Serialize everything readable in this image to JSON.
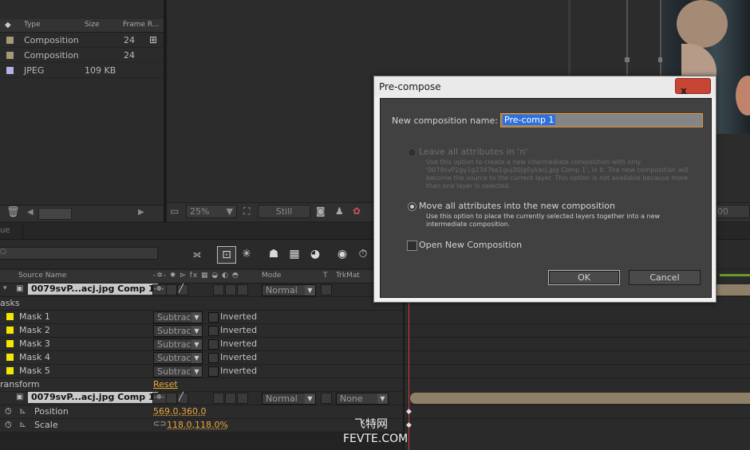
{
  "project": {
    "columns": {
      "type": "Type",
      "size": "Size",
      "frame_rate": "Frame R..."
    },
    "rows": [
      {
        "type": "Composition",
        "size": "",
        "frame_rate": "24",
        "swatch": "#a59977"
      },
      {
        "type": "Composition",
        "size": "",
        "frame_rate": "24",
        "swatch": "#a59977"
      },
      {
        "type": "JPEG",
        "size": "109 KB",
        "frame_rate": "",
        "swatch": "#b3b3e0"
      }
    ]
  },
  "viewer": {
    "zoom": "25%",
    "resolution": "Still"
  },
  "timeline": {
    "tab_partial": "ue",
    "columns": {
      "source_name": "Source Name",
      "mode": "Mode",
      "t": "T",
      "trkmat": "TrkMat"
    },
    "layer1": {
      "name": "0079svP...acj.jpg Comp 1",
      "mode": "Normal"
    },
    "masks_header": "asks",
    "masks": [
      {
        "name": "Mask 1",
        "mode": "Subtrac",
        "inverted": "Inverted"
      },
      {
        "name": "Mask 2",
        "mode": "Subtrac",
        "inverted": "Inverted"
      },
      {
        "name": "Mask 3",
        "mode": "Subtrac",
        "inverted": "Inverted"
      },
      {
        "name": "Mask 4",
        "mode": "Subtrac",
        "inverted": "Inverted"
      },
      {
        "name": "Mask 5",
        "mode": "Subtrac",
        "inverted": "Inverted"
      }
    ],
    "transform_header": "ransform",
    "reset": "Reset",
    "layer2": {
      "name": "0079svP...acj.jpg Comp 1",
      "mode": "Normal",
      "trkmat": "None"
    },
    "position": {
      "label": "Position",
      "value": "569.0,360.0"
    },
    "scale": {
      "label": "Scale",
      "value": "118.0,118.0%"
    }
  },
  "dialog": {
    "title": "Pre-compose",
    "close": "x",
    "name_label": "New composition name:",
    "name_value": "Pre-comp 1",
    "option_leave": {
      "label": "Leave all attributes in 'n'",
      "desc": "Use this option to create a new intermediate composition with only '0079svP2gy1g2347ke1guj30jg0ykacj.jpg Comp 1', in it. The new composition will become the source to the current layer. This option is not available because more than one layer is selected."
    },
    "option_move": {
      "label": "Move all attributes into the new composition",
      "desc": "Use this option to place the currently selected layers together into a new intermediate composition."
    },
    "open_new": "Open New Composition",
    "ok": "OK",
    "cancel": "Cancel"
  },
  "watermark": {
    "line1": "飞特网",
    "line2": "FEVTE.COM"
  }
}
